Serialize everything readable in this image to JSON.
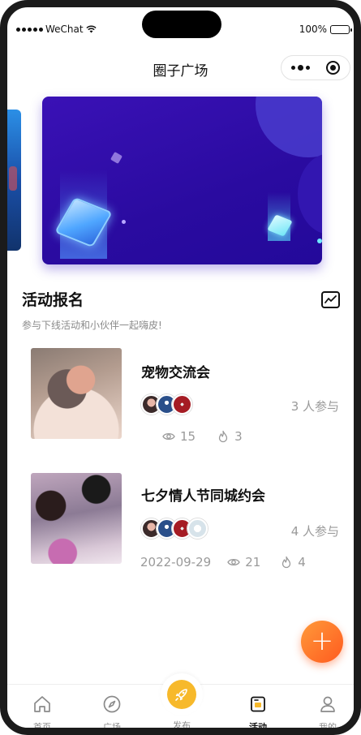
{
  "status_bar": {
    "carrier": "WeChat",
    "battery": "100%"
  },
  "navbar": {
    "title": "圈子广场"
  },
  "section": {
    "title": "活动报名",
    "subtitle": "参与下线活动和小伙伴一起嗨皮!"
  },
  "activities": [
    {
      "name": "宠物交流会",
      "participants": "3 人参与",
      "date": "",
      "views": "15",
      "likes": "3"
    },
    {
      "name": "七夕情人节同城约会",
      "participants": "4 人参与",
      "date": "2022-09-29",
      "views": "21",
      "likes": "4"
    }
  ],
  "fab": {
    "label": "+"
  },
  "tabbar": {
    "items": [
      {
        "label": "首页",
        "icon": "home-icon"
      },
      {
        "label": "广场",
        "icon": "compass-icon"
      },
      {
        "label": "发布",
        "icon": "rocket-icon"
      },
      {
        "label": "活动",
        "icon": "activity-icon"
      },
      {
        "label": "我的",
        "icon": "user-icon"
      }
    ],
    "active": "活动"
  },
  "colors": {
    "accent": "#ff6a2a",
    "publish": "#f7b92b",
    "banner": "#2a0ba0"
  }
}
